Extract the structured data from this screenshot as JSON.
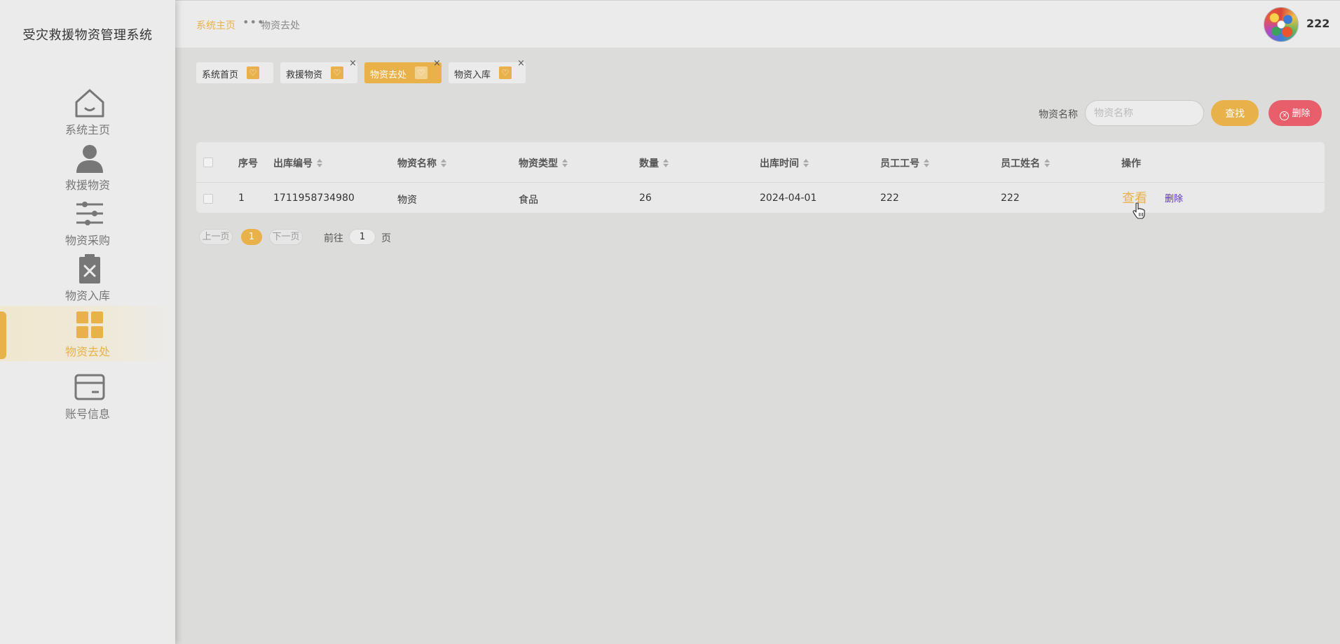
{
  "app": {
    "title": "受灾救援物资管理系统"
  },
  "sidebar": {
    "items": [
      {
        "label": "系统主页",
        "icon": "home-icon"
      },
      {
        "label": "救援物资",
        "icon": "user-icon"
      },
      {
        "label": "物资采购",
        "icon": "sliders-icon"
      },
      {
        "label": "物资入库",
        "icon": "clipboard-x-icon"
      },
      {
        "label": "物资去处",
        "icon": "grid-icon",
        "active": true
      },
      {
        "label": "账号信息",
        "icon": "card-icon"
      }
    ]
  },
  "header": {
    "breadcrumb_home": "系统主页",
    "breadcrumb_sep": "•••",
    "breadcrumb_current": "物资去处",
    "username": "222"
  },
  "tabs": [
    {
      "label": "系统首页",
      "closable": false
    },
    {
      "label": "救援物资",
      "closable": true,
      "close": "×"
    },
    {
      "label": "物资去处",
      "closable": true,
      "close": "×",
      "active": true
    },
    {
      "label": "物资入库",
      "closable": true,
      "close": "×"
    }
  ],
  "search": {
    "label": "物资名称",
    "placeholder": "物资名称",
    "search_button": "查找",
    "delete_button": "删除"
  },
  "table": {
    "columns": [
      "序号",
      "出库编号",
      "物资名称",
      "物资类型",
      "数量",
      "出库时间",
      "员工工号",
      "员工姓名",
      "操作"
    ],
    "rows": [
      {
        "index": "1",
        "out_no": "1711958734980",
        "name": "物资",
        "type": "食品",
        "qty": "26",
        "date": "2024-04-01",
        "emp_id": "222",
        "emp_name": "222",
        "view": "查看",
        "delete": "删除"
      }
    ]
  },
  "pagination": {
    "prev": "上一页",
    "current": "1",
    "next": "下一页",
    "goto_prefix": "前往",
    "goto_value": "1",
    "goto_suffix": "页"
  },
  "colors": {
    "accent": "#e9b14a",
    "danger": "#e85f6b",
    "link": "#5b2bd6"
  }
}
